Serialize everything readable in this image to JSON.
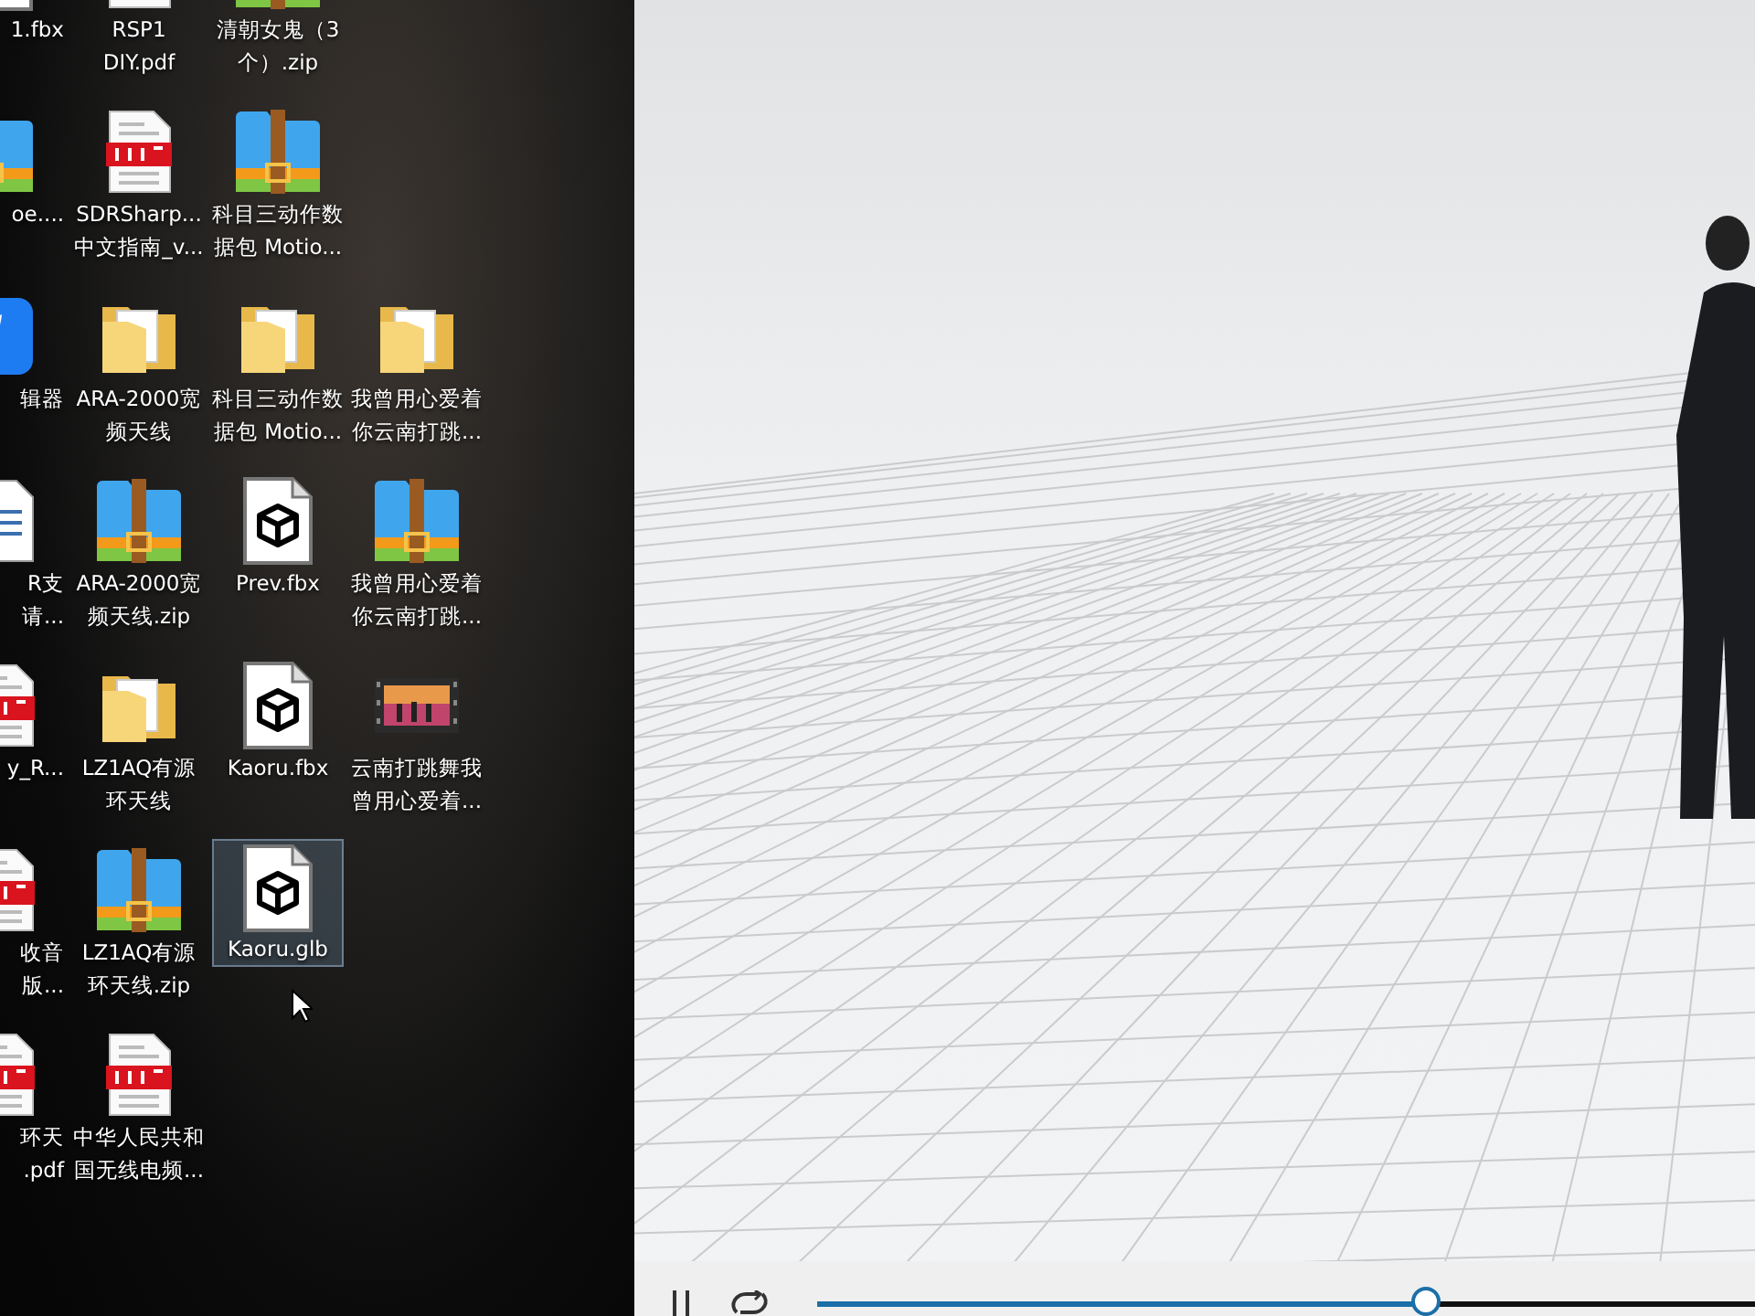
{
  "desktop": {
    "columns": [
      {
        "icons": [
          {
            "kind": "model",
            "lines": [
              "1.fbx"
            ],
            "selected": false
          },
          {
            "kind": "zip",
            "lines": [
              "oe...."
            ],
            "selected": false
          },
          {
            "kind": "app",
            "lines": [
              "辑器"
            ],
            "selected": false
          },
          {
            "kind": "doc",
            "lines": [
              "R支",
              "请..."
            ],
            "selected": false
          },
          {
            "kind": "pdf",
            "lines": [
              "y_R..."
            ],
            "selected": false
          },
          {
            "kind": "pdf",
            "lines": [
              "收音",
              "版..."
            ],
            "selected": false
          },
          {
            "kind": "pdf",
            "lines": [
              "环天",
              ".pdf"
            ],
            "selected": false
          }
        ]
      },
      {
        "icons": [
          {
            "kind": "pdf",
            "lines": [
              "RSP1",
              "DIY.pdf"
            ],
            "selected": false
          },
          {
            "kind": "pdf",
            "lines": [
              "SDRSharp...",
              "中文指南_v..."
            ],
            "selected": false
          },
          {
            "kind": "folder",
            "lines": [
              "ARA-2000宽",
              "频天线"
            ],
            "selected": false
          },
          {
            "kind": "zip",
            "lines": [
              "ARA-2000宽",
              "频天线.zip"
            ],
            "selected": false
          },
          {
            "kind": "folder",
            "lines": [
              "LZ1AQ有源",
              "环天线"
            ],
            "selected": false
          },
          {
            "kind": "zip",
            "lines": [
              "LZ1AQ有源",
              "环天线.zip"
            ],
            "selected": false
          },
          {
            "kind": "pdf",
            "lines": [
              "中华人民共和",
              "国无线电频..."
            ],
            "selected": false
          }
        ]
      },
      {
        "icons": [
          {
            "kind": "zip",
            "lines": [
              "清朝女鬼（3",
              "个）.zip"
            ],
            "selected": false
          },
          {
            "kind": "zip",
            "lines": [
              "科目三动作数",
              "据包 Motio..."
            ],
            "selected": false
          },
          {
            "kind": "folder",
            "lines": [
              "科目三动作数",
              "据包 Motio..."
            ],
            "selected": false
          },
          {
            "kind": "model",
            "lines": [
              "Prev.fbx"
            ],
            "selected": false
          },
          {
            "kind": "model",
            "lines": [
              "Kaoru.fbx"
            ],
            "selected": false
          },
          {
            "kind": "model",
            "lines": [
              "Kaoru.glb"
            ],
            "selected": true
          }
        ]
      },
      {
        "icons": [
          {
            "kind": "blank"
          },
          {
            "kind": "blank"
          },
          {
            "kind": "folder",
            "lines": [
              "我曾用心爱着",
              "你云南打跳..."
            ],
            "selected": false
          },
          {
            "kind": "zip",
            "lines": [
              "我曾用心爱着",
              "你云南打跳..."
            ],
            "selected": false
          },
          {
            "kind": "video",
            "lines": [
              "云南打跳舞我",
              "曾用心爱着..."
            ],
            "selected": false
          }
        ]
      }
    ]
  },
  "viewer": {
    "playback": {
      "playing": true,
      "loop": true,
      "level": 0.65
    }
  }
}
